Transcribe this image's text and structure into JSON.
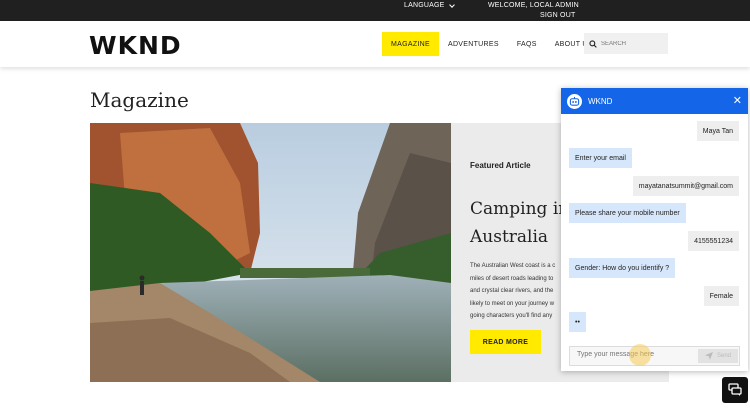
{
  "topbar": {
    "language": "LANGUAGE",
    "welcome": "WELCOME, LOCAL ADMIN",
    "signout": "SIGN OUT"
  },
  "header": {
    "logo": "WKND",
    "nav": [
      "MAGAZINE",
      "ADVENTURES",
      "FAQS",
      "ABOUT US"
    ],
    "active_nav": "MAGAZINE",
    "search_placeholder": "SEARCH"
  },
  "main": {
    "heading": "Magazine",
    "feature": {
      "kicker": "Featured Article",
      "title": "Camping in Western Australia",
      "title_visible": "Camping in Australia",
      "excerpt_lines": [
        "The Australian West coast is a c",
        "miles of desert roads leading to",
        "and crystal clear rivers, and the",
        "likely to meet on your journey w",
        "going characters you'll find any"
      ],
      "cta": "READ MORE"
    }
  },
  "chat": {
    "title": "WKND",
    "messages": [
      {
        "from": "user",
        "text": "Maya Tan"
      },
      {
        "from": "bot",
        "text": "Enter your email"
      },
      {
        "from": "user",
        "text": "mayatanatsummit@gmail.com"
      },
      {
        "from": "bot",
        "text": "Please share your mobile number"
      },
      {
        "from": "user",
        "text": "4155551234"
      },
      {
        "from": "bot",
        "text": "Gender: How do you identify ?"
      },
      {
        "from": "user",
        "text": "Female"
      },
      {
        "from": "bot",
        "text": "••"
      }
    ],
    "input_placeholder": "Type your message here",
    "send_label": "Send"
  },
  "colors": {
    "accent_yellow": "#ffea00",
    "chat_blue": "#1565e8",
    "bot_bubble": "#d7e7fb"
  }
}
